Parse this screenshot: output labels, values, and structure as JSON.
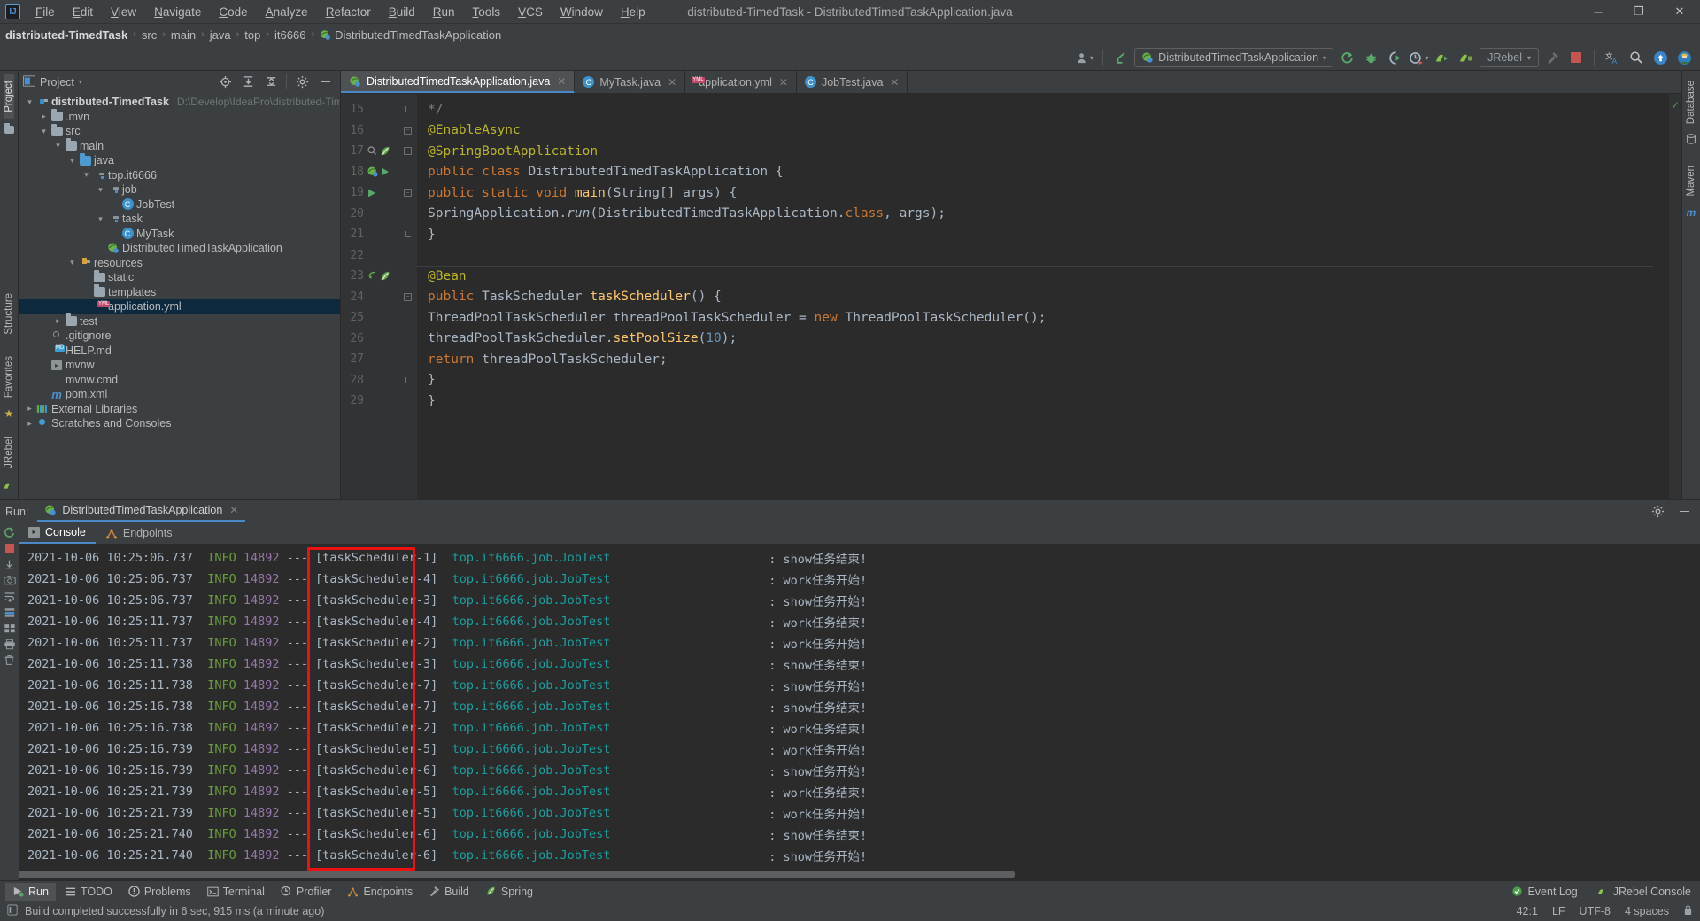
{
  "window": {
    "title": "distributed-TimedTask - DistributedTimedTaskApplication.java",
    "logo_text": "IJ",
    "minimize": "─",
    "maximize": "❐",
    "close": "✕"
  },
  "menubar": {
    "items": [
      "File",
      "Edit",
      "View",
      "Navigate",
      "Code",
      "Analyze",
      "Refactor",
      "Build",
      "Run",
      "Tools",
      "VCS",
      "Window",
      "Help"
    ]
  },
  "breadcrumb": {
    "items": [
      "distributed-TimedTask",
      "src",
      "main",
      "java",
      "top",
      "it6666",
      "DistributedTimedTaskApplication"
    ],
    "separator": "›"
  },
  "toolbar": {
    "run_config": "DistributedTimedTaskApplication",
    "jrebel_label": "JRebel",
    "caret": "▾",
    "icons": [
      "avatar-icon",
      "update-project-icon",
      "rerun-icon",
      "debug-icon",
      "run-with-coverage-icon",
      "profile-icon",
      "jrebel-run-icon",
      "jrebel-debug-icon",
      "hammer-icon",
      "stop-icon",
      "translate-icon",
      "search-everywhere-icon",
      "notifications-icon",
      "user-avatar-icon"
    ]
  },
  "left_strip": {
    "items": [
      "Project",
      "Structure",
      "Favorites",
      "JRebel"
    ]
  },
  "right_strip": {
    "items": [
      "Database",
      "Maven"
    ]
  },
  "project_panel": {
    "title": "Project",
    "caret": "▾",
    "header_icons": [
      "locate-icon",
      "expand-all-icon",
      "collapse-all-icon",
      "gear-icon",
      "hide-icon"
    ],
    "tree": [
      {
        "depth": 0,
        "arrow": "⌄",
        "icon": "module-folder-icon",
        "label": "distributed-TimedTask",
        "bold": true,
        "path": "D:\\Develop\\IdeaPro\\distributed-TimedTask",
        "selected": false
      },
      {
        "depth": 1,
        "arrow": "›",
        "icon": "folder-icon",
        "label": ".mvn",
        "bold": false,
        "path": "",
        "selected": false
      },
      {
        "depth": 1,
        "arrow": "⌄",
        "icon": "folder-icon",
        "label": "src",
        "bold": false,
        "path": "",
        "selected": false
      },
      {
        "depth": 2,
        "arrow": "⌄",
        "icon": "folder-icon",
        "label": "main",
        "bold": false,
        "path": "",
        "selected": false
      },
      {
        "depth": 3,
        "arrow": "⌄",
        "icon": "source-folder-icon",
        "label": "java",
        "bold": false,
        "path": "",
        "selected": false
      },
      {
        "depth": 4,
        "arrow": "⌄",
        "icon": "package-icon",
        "label": "top.it6666",
        "bold": false,
        "path": "",
        "selected": false
      },
      {
        "depth": 5,
        "arrow": "⌄",
        "icon": "package-icon",
        "label": "job",
        "bold": false,
        "path": "",
        "selected": false
      },
      {
        "depth": 6,
        "arrow": "",
        "icon": "java-class-icon",
        "label": "JobTest",
        "bold": false,
        "path": "",
        "selected": false
      },
      {
        "depth": 5,
        "arrow": "⌄",
        "icon": "package-icon",
        "label": "task",
        "bold": false,
        "path": "",
        "selected": false
      },
      {
        "depth": 6,
        "arrow": "",
        "icon": "java-class-icon",
        "label": "MyTask",
        "bold": false,
        "path": "",
        "selected": false
      },
      {
        "depth": 5,
        "arrow": "",
        "icon": "spring-class-icon",
        "label": "DistributedTimedTaskApplication",
        "bold": false,
        "path": "",
        "selected": false
      },
      {
        "depth": 3,
        "arrow": "⌄",
        "icon": "resources-folder-icon",
        "label": "resources",
        "bold": false,
        "path": "",
        "selected": false
      },
      {
        "depth": 4,
        "arrow": "",
        "icon": "folder-icon",
        "label": "static",
        "bold": false,
        "path": "",
        "selected": false
      },
      {
        "depth": 4,
        "arrow": "",
        "icon": "folder-icon",
        "label": "templates",
        "bold": false,
        "path": "",
        "selected": false
      },
      {
        "depth": 4,
        "arrow": "",
        "icon": "yml-file-icon",
        "label": "application.yml",
        "bold": false,
        "path": "",
        "selected": true
      },
      {
        "depth": 2,
        "arrow": "›",
        "icon": "folder-icon",
        "label": "test",
        "bold": false,
        "path": "",
        "selected": false
      },
      {
        "depth": 1,
        "arrow": "",
        "icon": "gitignore-file-icon",
        "label": ".gitignore",
        "bold": false,
        "path": "",
        "selected": false
      },
      {
        "depth": 1,
        "arrow": "",
        "icon": "md-file-icon",
        "label": "HELP.md",
        "bold": false,
        "path": "",
        "selected": false
      },
      {
        "depth": 1,
        "arrow": "",
        "icon": "script-file-icon",
        "label": "mvnw",
        "bold": false,
        "path": "",
        "selected": false
      },
      {
        "depth": 1,
        "arrow": "",
        "icon": "cmd-file-icon",
        "label": "mvnw.cmd",
        "bold": false,
        "path": "",
        "selected": false
      },
      {
        "depth": 1,
        "arrow": "",
        "icon": "maven-file-icon",
        "label": "pom.xml",
        "bold": false,
        "path": "",
        "selected": false
      },
      {
        "depth": 0,
        "arrow": "›",
        "icon": "libraries-icon",
        "label": "External Libraries",
        "bold": false,
        "path": "",
        "selected": false
      },
      {
        "depth": 0,
        "arrow": "›",
        "icon": "scratches-icon",
        "label": "Scratches and Consoles",
        "bold": false,
        "path": "",
        "selected": false
      }
    ]
  },
  "editor": {
    "tabs": [
      {
        "label": "DistributedTimedTaskApplication.java",
        "icon": "spring-class-icon",
        "active": true,
        "close": "✕"
      },
      {
        "label": "MyTask.java",
        "icon": "java-class-icon",
        "active": false,
        "close": "✕"
      },
      {
        "label": "application.yml",
        "icon": "yml-file-icon",
        "active": false,
        "close": "✕"
      },
      {
        "label": "JobTest.java",
        "icon": "java-class-icon",
        "active": false,
        "close": "✕"
      }
    ],
    "lines": [
      {
        "num": "15",
        "text": " */",
        "gutter": [],
        "fold": "end"
      },
      {
        "num": "16",
        "text": "@EnableAsync",
        "gutter": [],
        "fold": "start"
      },
      {
        "num": "17",
        "text": "@SpringBootApplication",
        "gutter": [
          "bean-icon",
          "spring-leaf-icon"
        ],
        "fold": "start"
      },
      {
        "num": "18",
        "text": "public class DistributedTimedTaskApplication {",
        "gutter": [
          "spring-bean-icon",
          "run-gutter-icon"
        ],
        "fold": ""
      },
      {
        "num": "19",
        "text": "    public static void main(String[] args) {",
        "gutter": [
          "run-gutter-icon"
        ],
        "fold": "start"
      },
      {
        "num": "20",
        "text": "        SpringApplication.run(DistributedTimedTaskApplication.class, args);",
        "gutter": [],
        "fold": ""
      },
      {
        "num": "21",
        "text": "    }",
        "gutter": [],
        "fold": "end"
      },
      {
        "num": "22",
        "text": "",
        "gutter": [],
        "fold": ""
      },
      {
        "num": "23",
        "text": "    @Bean",
        "gutter": [
          "navigate-icon",
          "spring-leaf-icon"
        ],
        "fold": ""
      },
      {
        "num": "24",
        "text": "    public TaskScheduler taskScheduler() {",
        "gutter": [],
        "fold": "start"
      },
      {
        "num": "25",
        "text": "        ThreadPoolTaskScheduler threadPoolTaskScheduler = new ThreadPoolTaskScheduler();",
        "gutter": [],
        "fold": ""
      },
      {
        "num": "26",
        "text": "        threadPoolTaskScheduler.setPoolSize(10);",
        "gutter": [],
        "fold": ""
      },
      {
        "num": "27",
        "text": "        return threadPoolTaskScheduler;",
        "gutter": [],
        "fold": ""
      },
      {
        "num": "28",
        "text": "    }",
        "gutter": [],
        "fold": "end"
      },
      {
        "num": "29",
        "text": "}",
        "gutter": [],
        "fold": ""
      }
    ],
    "inspection_status": "✓"
  },
  "run_panel": {
    "run_label": "Run:",
    "config_name": "DistributedTimedTaskApplication",
    "close": "✕",
    "header_icons": [
      "gear-icon",
      "hide-icon"
    ],
    "subtabs": [
      {
        "label": "Console",
        "icon": "console-icon",
        "active": true
      },
      {
        "label": "Endpoints",
        "icon": "endpoints-icon",
        "active": false
      }
    ],
    "side_icons": [
      "rerun-icon",
      "stop-icon",
      "camera-icon",
      "scroll-down-icon",
      "print-icon",
      "soft-wrap-icon",
      "filter-icon",
      "grid-icon",
      "printer-icon",
      "trash-icon"
    ],
    "highlight_color": "#ee1111",
    "log_columns": {
      "timestamp": "2021-10-06",
      "level": "INFO",
      "pid": "14892",
      "separator": "---",
      "logger": "top.it6666.job.JobTest"
    },
    "log_lines": [
      {
        "ts": "2021-10-06 10:25:06.737",
        "level": "INFO",
        "pid": "14892",
        "thread": "[taskScheduler-1]",
        "logger": "top.it6666.job.JobTest",
        "msg": ": show任务结束!"
      },
      {
        "ts": "2021-10-06 10:25:06.737",
        "level": "INFO",
        "pid": "14892",
        "thread": "[taskScheduler-4]",
        "logger": "top.it6666.job.JobTest",
        "msg": ": work任务开始!"
      },
      {
        "ts": "2021-10-06 10:25:06.737",
        "level": "INFO",
        "pid": "14892",
        "thread": "[taskScheduler-3]",
        "logger": "top.it6666.job.JobTest",
        "msg": ": show任务开始!"
      },
      {
        "ts": "2021-10-06 10:25:11.737",
        "level": "INFO",
        "pid": "14892",
        "thread": "[taskScheduler-4]",
        "logger": "top.it6666.job.JobTest",
        "msg": ": work任务结束!"
      },
      {
        "ts": "2021-10-06 10:25:11.737",
        "level": "INFO",
        "pid": "14892",
        "thread": "[taskScheduler-2]",
        "logger": "top.it6666.job.JobTest",
        "msg": ": work任务开始!"
      },
      {
        "ts": "2021-10-06 10:25:11.738",
        "level": "INFO",
        "pid": "14892",
        "thread": "[taskScheduler-3]",
        "logger": "top.it6666.job.JobTest",
        "msg": ": show任务结束!"
      },
      {
        "ts": "2021-10-06 10:25:11.738",
        "level": "INFO",
        "pid": "14892",
        "thread": "[taskScheduler-7]",
        "logger": "top.it6666.job.JobTest",
        "msg": ": show任务开始!"
      },
      {
        "ts": "2021-10-06 10:25:16.738",
        "level": "INFO",
        "pid": "14892",
        "thread": "[taskScheduler-7]",
        "logger": "top.it6666.job.JobTest",
        "msg": ": show任务结束!"
      },
      {
        "ts": "2021-10-06 10:25:16.738",
        "level": "INFO",
        "pid": "14892",
        "thread": "[taskScheduler-2]",
        "logger": "top.it6666.job.JobTest",
        "msg": ": work任务结束!"
      },
      {
        "ts": "2021-10-06 10:25:16.739",
        "level": "INFO",
        "pid": "14892",
        "thread": "[taskScheduler-5]",
        "logger": "top.it6666.job.JobTest",
        "msg": ": work任务开始!"
      },
      {
        "ts": "2021-10-06 10:25:16.739",
        "level": "INFO",
        "pid": "14892",
        "thread": "[taskScheduler-6]",
        "logger": "top.it6666.job.JobTest",
        "msg": ": show任务开始!"
      },
      {
        "ts": "2021-10-06 10:25:21.739",
        "level": "INFO",
        "pid": "14892",
        "thread": "[taskScheduler-5]",
        "logger": "top.it6666.job.JobTest",
        "msg": ": work任务结束!"
      },
      {
        "ts": "2021-10-06 10:25:21.739",
        "level": "INFO",
        "pid": "14892",
        "thread": "[taskScheduler-5]",
        "logger": "top.it6666.job.JobTest",
        "msg": ": work任务开始!"
      },
      {
        "ts": "2021-10-06 10:25:21.740",
        "level": "INFO",
        "pid": "14892",
        "thread": "[taskScheduler-6]",
        "logger": "top.it6666.job.JobTest",
        "msg": ": show任务结束!"
      },
      {
        "ts": "2021-10-06 10:25:21.740",
        "level": "INFO",
        "pid": "14892",
        "thread": "[taskScheduler-6]",
        "logger": "top.it6666.job.JobTest",
        "msg": ": show任务开始!"
      }
    ]
  },
  "bottom_bar": {
    "items": [
      {
        "label": "Run",
        "icon": "run-icon",
        "active": true
      },
      {
        "label": "TODO",
        "icon": "todo-icon",
        "active": false
      },
      {
        "label": "Problems",
        "icon": "problems-icon",
        "active": false
      },
      {
        "label": "Terminal",
        "icon": "terminal-icon",
        "active": false
      },
      {
        "label": "Profiler",
        "icon": "profiler-icon",
        "active": false
      },
      {
        "label": "Endpoints",
        "icon": "endpoints-icon",
        "active": false
      },
      {
        "label": "Build",
        "icon": "build-icon",
        "active": false
      },
      {
        "label": "Spring",
        "icon": "spring-icon",
        "active": false
      }
    ],
    "right_items": [
      {
        "label": "Event Log",
        "icon": "event-log-icon"
      },
      {
        "label": "JRebel Console",
        "icon": "jrebel-icon"
      }
    ]
  },
  "status_bar": {
    "message": "Build completed successfully in 6 sec, 915 ms (a minute ago)",
    "message_icon": "build-status-icon",
    "caret_position": "42:1",
    "line_separator": "LF",
    "encoding": "UTF-8",
    "indent": "4 spaces",
    "lock_icon": "lock-icon"
  },
  "colors": {
    "accent": "#4a88c7",
    "selection": "#0d293e",
    "editor_bg": "#2b2b2b",
    "panel_bg": "#3c3f41",
    "highlight": "#ee1111",
    "green": "#5c9c4f",
    "keyword": "#cc7832",
    "annotation": "#bbb529",
    "method": "#ffc66d",
    "number": "#6897bb",
    "logger_cyan": "#1a9fa0",
    "level_green": "#6a9b3f",
    "pid_purple": "#9876aa"
  }
}
